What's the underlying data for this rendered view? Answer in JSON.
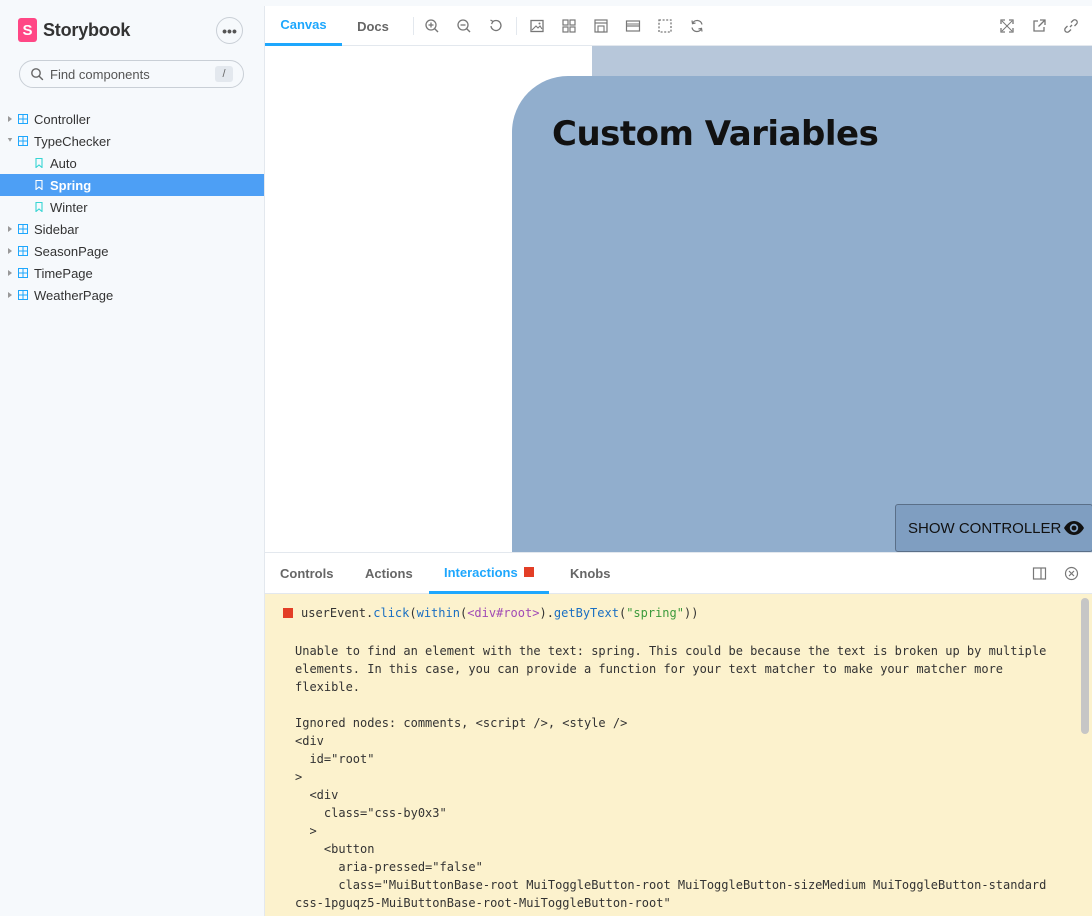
{
  "sidebar": {
    "brand": "Storybook",
    "brand_logo_letter": "S",
    "menu_label": "•••",
    "search_placeholder": "Find components",
    "search_shortcut": "/",
    "items": [
      {
        "label": "Controller",
        "kind": "component"
      },
      {
        "label": "TypeChecker",
        "kind": "component",
        "expanded": true
      },
      {
        "label": "Auto",
        "kind": "story"
      },
      {
        "label": "Spring",
        "kind": "story",
        "selected": true
      },
      {
        "label": "Winter",
        "kind": "story"
      },
      {
        "label": "Sidebar",
        "kind": "component"
      },
      {
        "label": "SeasonPage",
        "kind": "component"
      },
      {
        "label": "TimePage",
        "kind": "component"
      },
      {
        "label": "WeatherPage",
        "kind": "component"
      }
    ]
  },
  "toolbar": {
    "tabs": [
      {
        "label": "Canvas",
        "active": true
      },
      {
        "label": "Docs",
        "active": false
      }
    ],
    "tools": [
      "zoom-in-icon",
      "zoom-out-icon",
      "zoom-reset-icon",
      "background-icon",
      "grid-icon",
      "viewport-icon",
      "measure-icon",
      "outline-icon",
      "remount-icon"
    ],
    "right_tools": [
      "fullscreen-icon",
      "open-new-tab-icon",
      "copy-link-icon"
    ]
  },
  "canvas": {
    "title": "Custom Variables",
    "show_controller_label": "SHOW CONTROLLER",
    "card_color": "#91aecd",
    "strip_color": "#b7c7da"
  },
  "panel": {
    "tabs": [
      {
        "label": "Controls",
        "active": false
      },
      {
        "label": "Actions",
        "active": false
      },
      {
        "label": "Interactions",
        "active": true,
        "error": true
      },
      {
        "label": "Knobs",
        "active": false
      }
    ],
    "log": {
      "call": {
        "object": "userEvent.",
        "method": "click",
        "open1": "(",
        "within": "within",
        "open2": "(",
        "element": "<div#root>",
        "close2": ")",
        "dot": ".",
        "query": "getByText",
        "open3": "(",
        "arg": "\"spring\"",
        "close": "))"
      },
      "message": "Unable to find an element with the text: spring. This could be because the text is broken up by multiple\nelements. In this case, you can provide a function for your text matcher to make your matcher more\nflexible.\n\nIgnored nodes: comments, <script />, <style />\n<div\n  id=\"root\"\n>\n  <div\n    class=\"css-by0x3\"\n  >\n    <button\n      aria-pressed=\"false\"\n      class=\"MuiButtonBase-root MuiToggleButton-root MuiToggleButton-sizeMedium MuiToggleButton-standard\ncss-1pguqz5-MuiButtonBase-root-MuiToggleButton-root\""
    }
  },
  "colors": {
    "accent": "#1ea7fd",
    "selected": "#4d9ff5",
    "error": "#e33e26",
    "log_bg": "#fcf2cd"
  }
}
